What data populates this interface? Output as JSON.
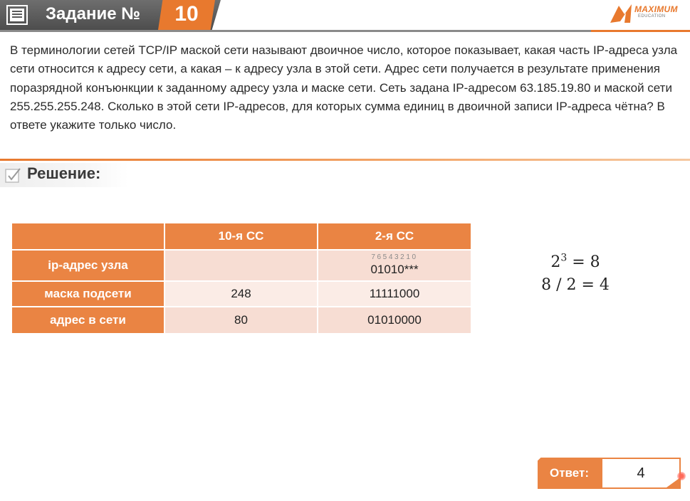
{
  "header": {
    "task_label": "Задание №",
    "task_number": "10",
    "icon": "document-list-icon",
    "logo_text": "MAXIMUM",
    "logo_subtext": "EDUCATION",
    "logo_icon": "maximum-logo-icon"
  },
  "problem": {
    "text": "В терминологии сетей TCP/IP маской сети называют двоичное число, которое показывает, какая часть IP-адреса узла сети относится к адресу сети, а какая – к адресу узла в этой сети. Адрес сети получается в результате применения поразрядной конъюнкции к заданному адресу узла и маске сети. Сеть задана IP-адресом 63.185.19.80 и маской сети 255.255.255.248. Сколько в этой сети IP-адресов, для которых сумма единиц в двоичной записи IP-адреса чётна? В ответе укажите только число."
  },
  "solution": {
    "title": "Решение:",
    "icon": "checkbox-checked-icon"
  },
  "table": {
    "headers": [
      "",
      "10-я СС",
      "2-я СС"
    ],
    "rows": [
      {
        "label": "ip-адрес узла",
        "dec": "",
        "bin": "01010***",
        "bit_index": "76543210"
      },
      {
        "label": "маска подсети",
        "dec": "248",
        "bin": "11111000"
      },
      {
        "label": "адрес в сети",
        "dec": "80",
        "bin": "01010000"
      }
    ]
  },
  "formulas": {
    "line1_base": "2",
    "line1_exp": "3",
    "line1_rest": " = 8",
    "line2": "8 / 2 = 4"
  },
  "answer": {
    "label": "Ответ:",
    "value": "4"
  },
  "colors": {
    "accent": "#ea8443",
    "header_gray": "#5a5a5a",
    "cell_light": "#f7ddd3",
    "cell_lighter": "#fbece6"
  }
}
